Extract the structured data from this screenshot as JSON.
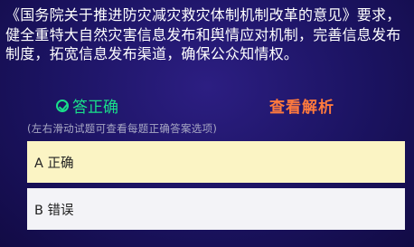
{
  "question": {
    "text": "《国务院关于推进防灾减灾救灾体制机制改革的意见》要求，健全重特大自然灾害信息发布和舆情应对机制，完善信息发布制度，拓宽信息发布渠道，确保公众知情权。"
  },
  "answer": {
    "correct_label": "答正确",
    "analysis_label": "查看解析"
  },
  "hint": {
    "text": "(左右滑动试题可查看每题正确答案选项)"
  },
  "options": [
    {
      "label": "A 正确",
      "state": "selected",
      "color": "#fbf4c4"
    },
    {
      "label": "B 错误",
      "state": "unselected",
      "color": "#f3f3f7"
    }
  ],
  "colors": {
    "correct": "#19e08a",
    "analysis": "#ff7a3d",
    "background": "#1b1361"
  },
  "icons": {
    "correct_icon": "check-circle-icon"
  }
}
